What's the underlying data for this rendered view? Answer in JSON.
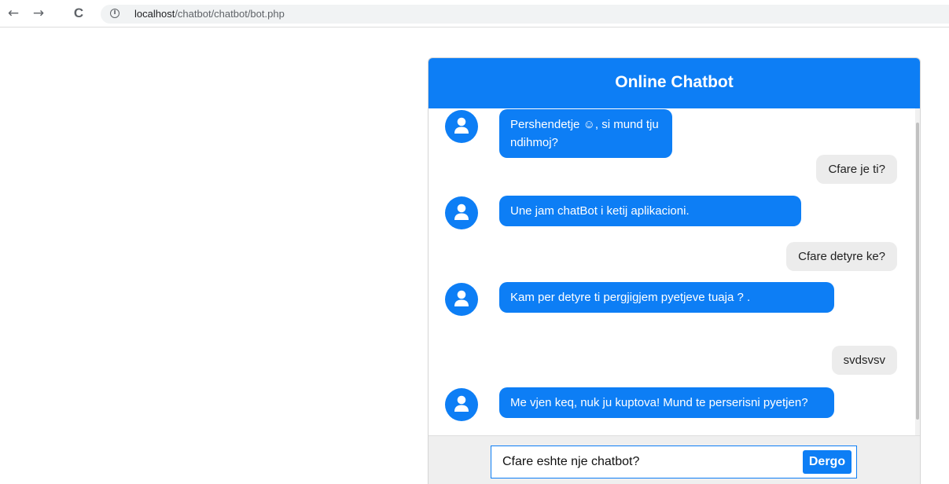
{
  "browser": {
    "url_host": "localhost",
    "url_path": "/chatbot/chatbot/bot.php",
    "back_icon": "←",
    "forward_icon": "→",
    "reload_icon": "C",
    "info_icon": "i"
  },
  "chat": {
    "title": "Online Chatbot",
    "accent_color": "#0d7ef5",
    "messages": [
      {
        "from": "bot",
        "text": "Pershendetje ☺, si mund tju ndihmoj?"
      },
      {
        "from": "user",
        "text": "Cfare je ti?"
      },
      {
        "from": "bot",
        "text": "Une jam chatBot i ketij aplikacioni."
      },
      {
        "from": "user",
        "text": "Cfare detyre ke?"
      },
      {
        "from": "bot",
        "text": "Kam per detyre ti pergjigjem pyetjeve tuaja ? ."
      },
      {
        "from": "user",
        "text": "svdsvsv"
      },
      {
        "from": "bot",
        "text": "Me vjen keq, nuk ju kuptova! Mund te perserisni pyetjen?"
      }
    ],
    "input_value": "Cfare eshte nje chatbot?",
    "send_label": "Dergo"
  }
}
